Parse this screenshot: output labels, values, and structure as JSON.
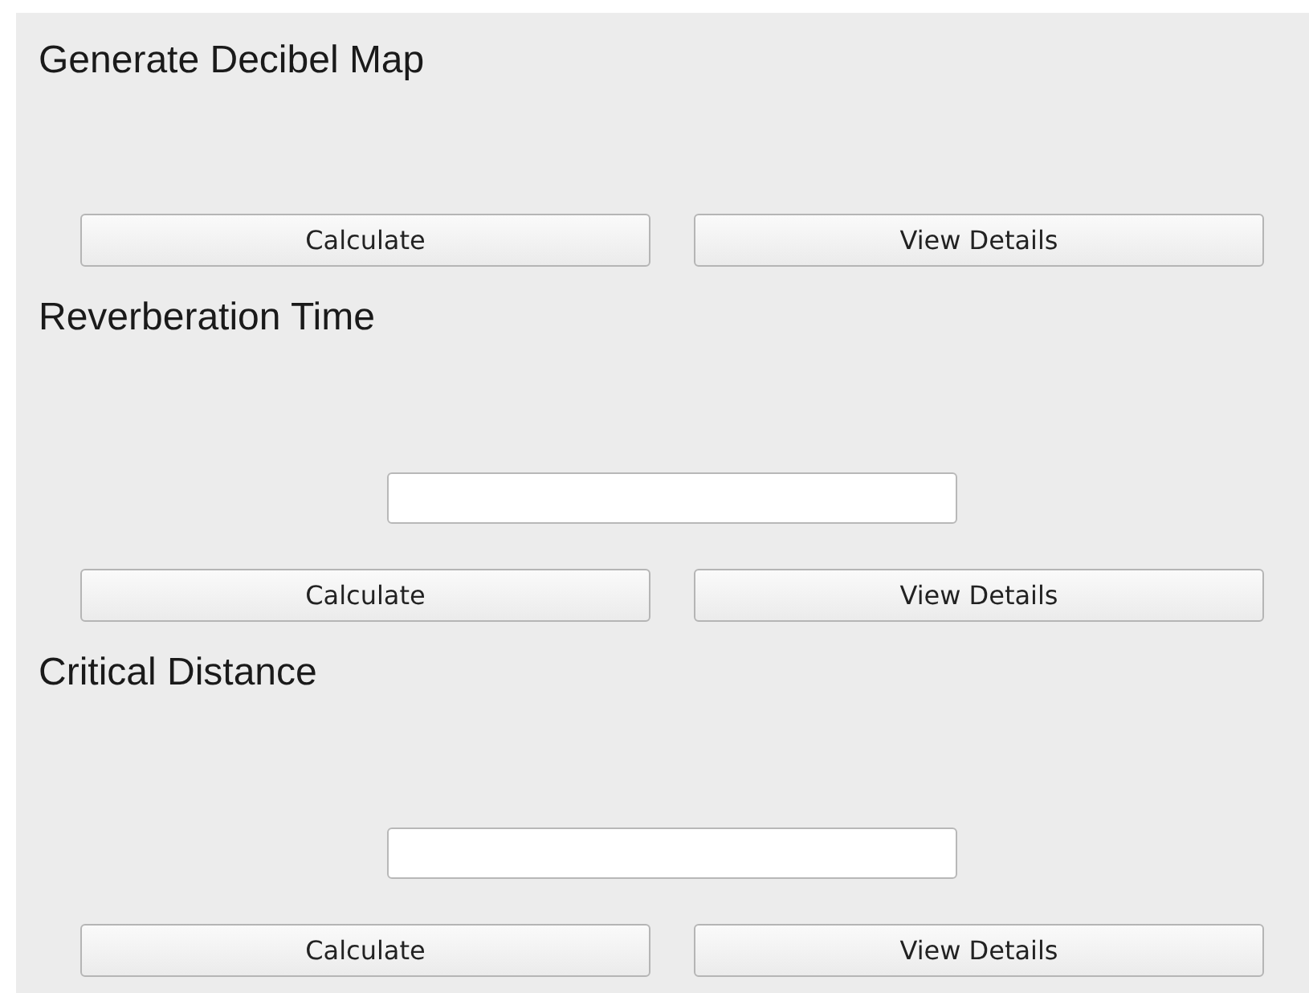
{
  "sections": [
    {
      "title": "Generate Decibel Map",
      "kind": "plain",
      "buttons": [
        "Calculate",
        "View Details"
      ]
    },
    {
      "title": "Reverberation Time",
      "kind": "input",
      "buttons": [
        "Calculate",
        "View Details"
      ]
    },
    {
      "title": "Critical Distance",
      "kind": "input",
      "buttons": [
        "Calculate",
        "View Details"
      ]
    }
  ]
}
